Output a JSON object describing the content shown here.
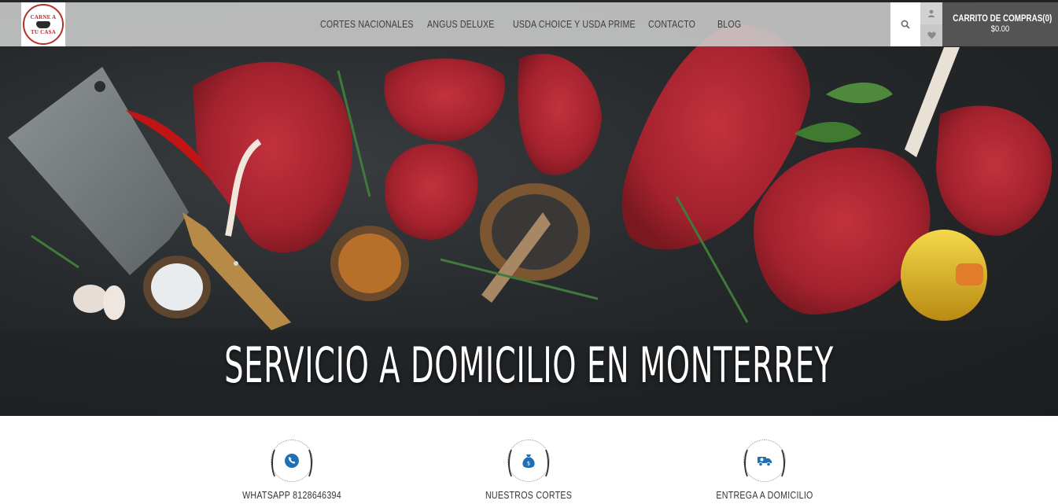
{
  "header": {
    "logo_text_top": "CARNE A",
    "logo_text_bottom": "TU CASA",
    "nav": [
      {
        "label": "CORTES NACIONALES"
      },
      {
        "label": "ANGUS DELUXE"
      },
      {
        "label": "USDA CHOICE Y USDA PRIME"
      },
      {
        "label": "CONTACTO"
      },
      {
        "label": "BLOG"
      }
    ],
    "search_icon": "search-icon",
    "account_icon": "user-icon",
    "wishlist_icon": "heart-icon",
    "cart": {
      "title": "CARRITO DE COMPRAS(0)",
      "total": "$0.00"
    }
  },
  "hero": {
    "title": "SERVICIO A DOMICILIO EN MONTERREY"
  },
  "features": [
    {
      "label": "WHATSAPP 8128646394",
      "icon": "phone-icon"
    },
    {
      "label": "NUESTROS CORTES",
      "icon": "money-bag-icon"
    },
    {
      "label": "ENTREGA A DOMICILIO",
      "icon": "delivery-truck-icon"
    }
  ],
  "colors": {
    "header_bg": "#cdcdcd",
    "cart_bg": "#545454",
    "brand_red": "#b5302d",
    "icon_blue": "#1f6fb2"
  }
}
